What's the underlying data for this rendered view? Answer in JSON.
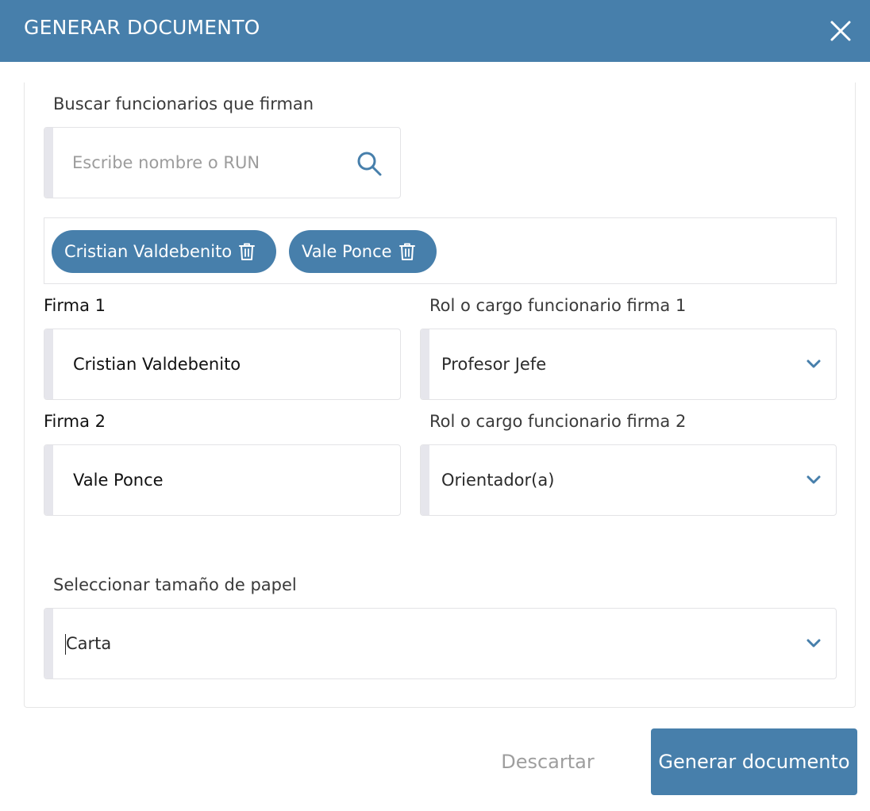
{
  "dialog": {
    "title": "GENERAR DOCUMENTO"
  },
  "search": {
    "label": "Buscar funcionarios que firman",
    "placeholder": "Escribe nombre o RUN"
  },
  "chips": [
    {
      "label": "Cristian Valdebenito"
    },
    {
      "label": "Vale Ponce"
    }
  ],
  "firma1": {
    "label": "Firma 1",
    "value": "Cristian Valdebenito",
    "rol_label": "Rol o cargo funcionario firma 1",
    "rol_value": "Profesor Jefe"
  },
  "firma2": {
    "label": "Firma 2",
    "value": "Vale Ponce",
    "rol_label": "Rol o cargo funcionario firma 2",
    "rol_value": "Orientador(a)"
  },
  "paper": {
    "label": "Seleccionar tamaño de papel",
    "value": "Carta"
  },
  "footer": {
    "discard_label": "Descartar",
    "generate_label": "Generar documento"
  },
  "colors": {
    "primary": "#477fab",
    "muted": "#9e9e9e"
  },
  "icons": [
    "close-icon",
    "search-icon",
    "trash-icon",
    "chevron-down-icon"
  ]
}
